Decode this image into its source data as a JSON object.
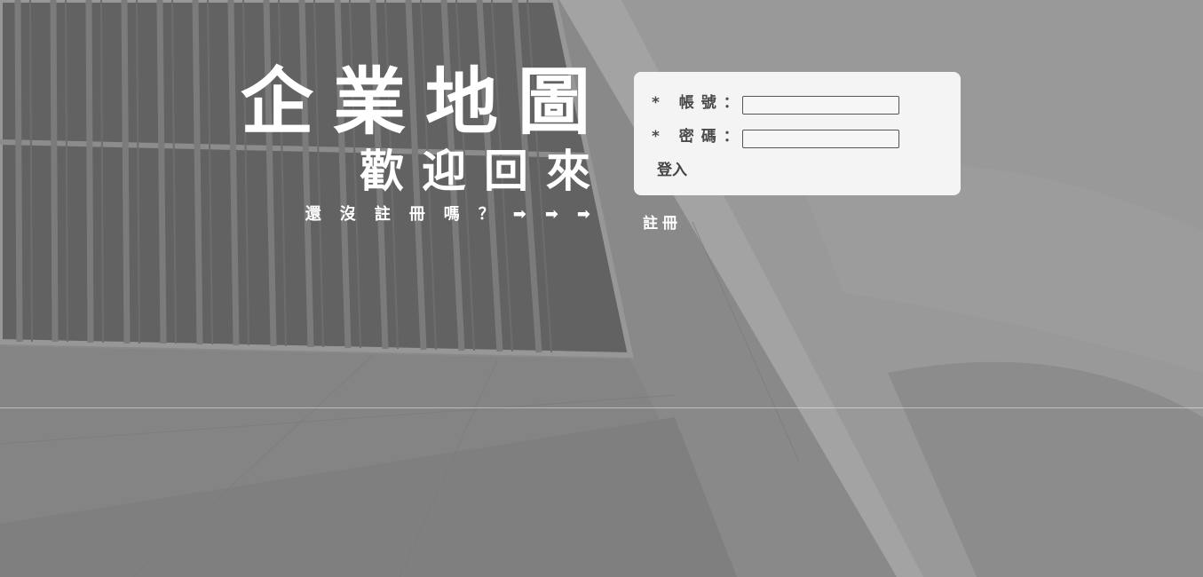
{
  "hero": {
    "title": "企業地圖",
    "subtitle": "歡迎回來",
    "prompt": "還沒註冊嗎？➡➡➡"
  },
  "login": {
    "account_label": "* 帳號：",
    "account_value": "",
    "password_label": "* 密碼：",
    "password_value": "",
    "login_button": "登入"
  },
  "register": {
    "link_label": "註冊"
  },
  "colors": {
    "background": "#8d8d8d",
    "card": "#f4f4f4",
    "hero_text": "#ffffff",
    "label_text": "#4a4a4a"
  }
}
